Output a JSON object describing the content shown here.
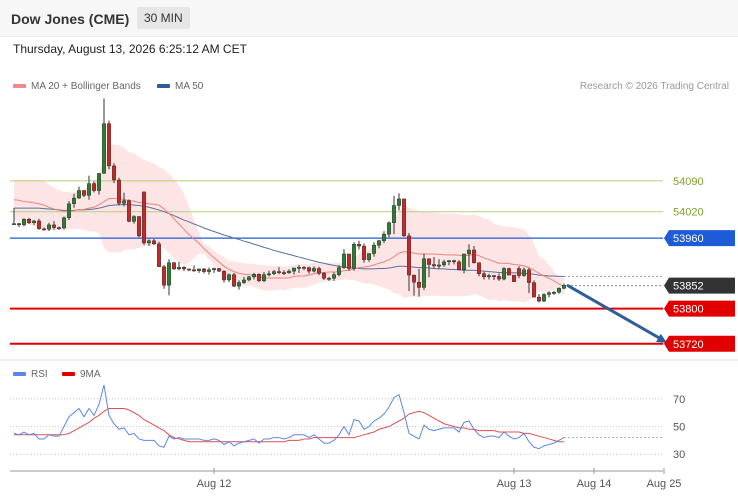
{
  "header": {
    "title": "Dow Jones (CME)",
    "timeframe": "30 MIN"
  },
  "datetime": "Thursday, August 13, 2026 6:25:12 AM CET",
  "legend": {
    "ma20_label": "MA 20 + Bollinger Bands",
    "ma50_label": "MA 50",
    "credit": "Research © 2026 Trading Central"
  },
  "rsi_legend": {
    "rsi_label": "RSI",
    "ma9_label": "9MA"
  },
  "colors": {
    "bull": "#2e7d32",
    "bear": "#c62828",
    "band": "#fde0e0",
    "ma20": "#f08080",
    "ma50": "#5a6f9e",
    "blue_level": "#1e5bd6",
    "red_level": "#e00000",
    "arrow": "#2f5d9c",
    "rsi": "#5b87e8",
    "rsi_ma": "#e05050"
  },
  "chart_data": {
    "type": "candlestick",
    "y_range": [
      53690,
      54310
    ],
    "levels": [
      {
        "value": 54090,
        "label": "54090",
        "style": "resistance-thin"
      },
      {
        "value": 54020,
        "label": "54020",
        "style": "resistance-thin"
      },
      {
        "value": 53960,
        "label": "53960",
        "style": "blue"
      },
      {
        "value": 53852,
        "label": "53852",
        "style": "current"
      },
      {
        "value": 53800,
        "label": "53800",
        "style": "red"
      },
      {
        "value": 53720,
        "label": "53720",
        "style": "red"
      }
    ],
    "x_labels": [
      {
        "label": "Aug 12",
        "index": 40
      },
      {
        "label": "Aug 13",
        "index": 100
      },
      {
        "label": "Aug 14",
        "index": 116
      },
      {
        "label": "Aug 25",
        "index": 130
      }
    ],
    "bars_count": 111,
    "candles": [
      [
        53992,
        53993,
        53993,
        54028
      ],
      [
        53993,
        53990,
        53985,
        53995
      ],
      [
        53990,
        54003,
        53987,
        54005
      ],
      [
        54003,
        53995,
        53992,
        54006
      ],
      [
        53995,
        53999,
        53990,
        54001
      ],
      [
        53999,
        53981,
        53979,
        54004
      ],
      [
        53981,
        53980,
        53978,
        53984
      ],
      [
        53980,
        53990,
        53976,
        53995
      ],
      [
        53990,
        53984,
        53979,
        53999
      ],
      [
        53984,
        53983,
        53979,
        53986
      ],
      [
        53983,
        54006,
        53980,
        54009
      ],
      [
        54006,
        54038,
        54001,
        54044
      ],
      [
        54038,
        54051,
        54029,
        54061
      ],
      [
        54051,
        54068,
        54049,
        54077
      ],
      [
        54068,
        54057,
        54053,
        54069
      ],
      [
        54057,
        54084,
        54047,
        54102
      ],
      [
        54084,
        54068,
        54064,
        54089
      ],
      [
        54068,
        54107,
        54059,
        54107
      ],
      [
        54107,
        54220,
        54106,
        54277
      ],
      [
        54220,
        54124,
        54116,
        54227
      ],
      [
        54124,
        54092,
        54085,
        54130
      ],
      [
        54092,
        54039,
        54034,
        54097
      ],
      [
        54039,
        54045,
        54032,
        54063
      ],
      [
        54045,
        53998,
        53996,
        54048
      ],
      [
        53998,
        54009,
        53993,
        54012
      ],
      [
        54009,
        53965,
        53962,
        54010
      ],
      [
        54065,
        53949,
        53944,
        53984
      ],
      [
        53949,
        53954,
        53942,
        53957
      ],
      [
        53954,
        53947,
        53944,
        53958
      ],
      [
        53947,
        53895,
        53895,
        53952
      ],
      [
        53895,
        53853,
        53845,
        53899
      ],
      [
        53853,
        53904,
        53830,
        53912
      ],
      [
        53904,
        53890,
        53888,
        53906
      ],
      [
        53890,
        53894,
        53887,
        53906
      ],
      [
        53894,
        53890,
        53885,
        53896
      ],
      [
        53890,
        53888,
        53885,
        53890
      ],
      [
        53888,
        53886,
        53884,
        53898
      ],
      [
        53886,
        53890,
        53881,
        53891
      ],
      [
        53890,
        53884,
        53880,
        53892
      ],
      [
        53884,
        53888,
        53877,
        53893
      ],
      [
        53888,
        53891,
        53881,
        53893
      ],
      [
        53891,
        53885,
        53883,
        53892
      ],
      [
        53885,
        53865,
        53859,
        53887
      ],
      [
        53865,
        53877,
        53860,
        53880
      ],
      [
        53877,
        53851,
        53849,
        53881
      ],
      [
        53851,
        53859,
        53843,
        53864
      ],
      [
        53859,
        53865,
        53856,
        53872
      ],
      [
        53865,
        53872,
        53862,
        53874
      ],
      [
        53872,
        53878,
        53866,
        53881
      ],
      [
        53878,
        53863,
        53860,
        53880
      ],
      [
        53863,
        53877,
        53860,
        53883
      ],
      [
        53877,
        53879,
        53873,
        53886
      ],
      [
        53879,
        53884,
        53876,
        53888
      ],
      [
        53884,
        53882,
        53878,
        53894
      ],
      [
        53882,
        53881,
        53876,
        53887
      ],
      [
        53881,
        53885,
        53879,
        53889
      ],
      [
        53885,
        53892,
        53877,
        53893
      ],
      [
        53892,
        53894,
        53881,
        53899
      ],
      [
        53894,
        53893,
        53887,
        53896
      ],
      [
        53893,
        53885,
        53879,
        53895
      ],
      [
        53885,
        53891,
        53882,
        53896
      ],
      [
        53891,
        53880,
        53876,
        53895
      ],
      [
        53880,
        53869,
        53865,
        53883
      ],
      [
        53869,
        53869,
        53863,
        53872
      ],
      [
        53869,
        53877,
        53863,
        53882
      ],
      [
        53877,
        53893,
        53873,
        53898
      ],
      [
        53893,
        53924,
        53890,
        53935
      ],
      [
        53924,
        53891,
        53886,
        53924
      ],
      [
        53891,
        53946,
        53886,
        53951
      ],
      [
        53946,
        53942,
        53934,
        53954
      ],
      [
        53942,
        53911,
        53904,
        53948
      ],
      [
        53911,
        53925,
        53906,
        53926
      ],
      [
        53925,
        53944,
        53918,
        53951
      ],
      [
        53944,
        53954,
        53937,
        53956
      ],
      [
        53954,
        53969,
        53949,
        53976
      ],
      [
        53969,
        53995,
        53962,
        53998
      ],
      [
        53995,
        54034,
        53969,
        54056
      ],
      [
        54034,
        54049,
        54023,
        54062
      ],
      [
        54049,
        53965,
        53963,
        54049
      ],
      [
        53965,
        53876,
        53840,
        53972
      ],
      [
        53876,
        53860,
        53829,
        53877
      ],
      [
        53860,
        53848,
        53827,
        53890
      ],
      [
        53848,
        53913,
        53842,
        53925
      ],
      [
        53913,
        53900,
        53871,
        53914
      ],
      [
        53900,
        53897,
        53892,
        53917
      ],
      [
        53897,
        53899,
        53891,
        53912
      ],
      [
        53899,
        53906,
        53895,
        53911
      ],
      [
        53906,
        53909,
        53898,
        53910
      ],
      [
        53909,
        53906,
        53900,
        53911
      ],
      [
        53906,
        53888,
        53887,
        53910
      ],
      [
        53888,
        53924,
        53880,
        53924
      ],
      [
        53924,
        53933,
        53894,
        53946
      ],
      [
        53933,
        53904,
        53902,
        53942
      ],
      [
        53904,
        53879,
        53873,
        53905
      ],
      [
        53879,
        53872,
        53866,
        53884
      ],
      [
        53872,
        53875,
        53866,
        53879
      ],
      [
        53875,
        53873,
        53865,
        53876
      ],
      [
        53873,
        53867,
        53863,
        53880
      ],
      [
        53867,
        53891,
        53864,
        53894
      ],
      [
        53891,
        53876,
        53876,
        53893
      ],
      [
        53876,
        53861,
        53862,
        53876
      ],
      [
        53891,
        53875,
        53869,
        53896
      ],
      [
        53875,
        53888,
        53872,
        53893
      ],
      [
        53888,
        53859,
        53835,
        53892
      ],
      [
        53859,
        53826,
        53827,
        53864
      ],
      [
        53826,
        53817,
        53814,
        53833
      ],
      [
        53817,
        53832,
        53815,
        53835
      ],
      [
        53832,
        53836,
        53825,
        53839
      ],
      [
        53836,
        53837,
        53831,
        53840
      ],
      [
        53837,
        53846,
        53834,
        53848
      ],
      [
        53846,
        53853,
        53844,
        53857
      ]
    ],
    "ma20": [
      54047,
      54046,
      54043,
      54042,
      54040,
      54038,
      54035,
      54030,
      54026,
      54023,
      54021,
      54022,
      54022,
      54025,
      54025,
      54028,
      54030,
      54036,
      54043,
      54050,
      54050,
      54049,
      54048,
      54045,
      54044,
      54041,
      54040,
      54038,
      54037,
      54035,
      54026,
      54016,
      54004,
      53992,
      53980,
      53968,
      53958,
      53948,
      53936,
      53926,
      53915,
      53906,
      53896,
      53889,
      53884,
      53880,
      53878,
      53877,
      53875,
      53872,
      53870,
      53869,
      53869,
      53870,
      53869,
      53870,
      53873,
      53874,
      53874,
      53876,
      53879,
      53881,
      53882,
      53883,
      53883,
      53884,
      53886,
      53887,
      53890,
      53893,
      53894,
      53896,
      53899,
      53903,
      53906,
      53911,
      53918,
      53926,
      53929,
      53928,
      53926,
      53924,
      53924,
      53924,
      53924,
      53923,
      53922,
      53922,
      53922,
      53921,
      53920,
      53921,
      53923,
      53920,
      53915,
      53911,
      53907,
      53903,
      53903,
      53902,
      53900,
      53899,
      53897,
      53893,
      53887,
      53880,
      53874,
      53869,
      53863,
      53856,
      53850
    ],
    "upper_band": [
      54093,
      54093,
      54093,
      54093,
      54093,
      54093,
      54089,
      54081,
      54075,
      54068,
      54065,
      54064,
      54063,
      54070,
      54071,
      54080,
      54085,
      54101,
      54148,
      54172,
      54172,
      54171,
      54165,
      54155,
      54153,
      54144,
      54138,
      54134,
      54129,
      54121,
      54116,
      54106,
      54094,
      54080,
      54061,
      54033,
      54002,
      53971,
      53948,
      53941,
      53932,
      53923,
      53917,
      53909,
      53907,
      53905,
      53903,
      53902,
      53901,
      53899,
      53899,
      53897,
      53897,
      53897,
      53896,
      53896,
      53899,
      53901,
      53901,
      53902,
      53904,
      53903,
      53903,
      53904,
      53904,
      53904,
      53906,
      53909,
      53915,
      53925,
      53932,
      53935,
      53943,
      53955,
      53966,
      53979,
      54001,
      54019,
      54034,
      54029,
      54025,
      54022,
      54019,
      54019,
      54019,
      54017,
      54016,
      54016,
      54016,
      54014,
      54012,
      54012,
      54013,
      54010,
      54005,
      54003,
      53993,
      53989,
      53987,
      53986,
      53984,
      53982,
      53980,
      53967,
      53949,
      53919,
      53913,
      53899,
      53884,
      53872,
      53870
    ],
    "lower_band": [
      54001,
      53999,
      53993,
      53991,
      53987,
      53983,
      53981,
      53979,
      53977,
      53978,
      53977,
      53980,
      53981,
      53980,
      53979,
      53976,
      53975,
      53971,
      53938,
      53928,
      53928,
      53927,
      53931,
      53935,
      53935,
      53938,
      53942,
      53942,
      53945,
      53949,
      53936,
      53926,
      53914,
      53904,
      53899,
      53903,
      53914,
      53925,
      53924,
      53911,
      53898,
      53889,
      53875,
      53869,
      53861,
      53855,
      53853,
      53852,
      53849,
      53845,
      53841,
      53841,
      53841,
      53843,
      53842,
      53844,
      53847,
      53847,
      53847,
      53850,
      53854,
      53859,
      53861,
      53862,
      53862,
      53864,
      53866,
      53865,
      53865,
      53861,
      53856,
      53857,
      53855,
      53851,
      53846,
      53843,
      53835,
      53833,
      53824,
      53827,
      53827,
      53826,
      53829,
      53829,
      53829,
      53829,
      53828,
      53828,
      53828,
      53828,
      53828,
      53830,
      53833,
      53830,
      53825,
      53819,
      53821,
      53817,
      53819,
      53818,
      53816,
      53816,
      53814,
      53819,
      53825,
      53841,
      53835,
      53839,
      53842,
      53840,
      53830
    ],
    "ma50": [
      54028,
      54028,
      54028,
      54028,
      54028,
      54028,
      54027,
      54026,
      54025,
      54024,
      54023,
      54023,
      54023,
      54024,
      54024,
      54025,
      54026,
      54028,
      54031,
      54034,
      54035,
      54036,
      54036,
      54036,
      54035,
      54034,
      54032,
      54030,
      54027,
      54024,
      54020,
      54016,
      54011,
      54006,
      54001,
      53997,
      53992,
      53988,
      53983,
      53979,
      53975,
      53971,
      53967,
      53964,
      53960,
      53957,
      53953,
      53950,
      53946,
      53943,
      53939,
      53936,
      53932,
      53929,
      53926,
      53923,
      53920,
      53917,
      53914,
      53911,
      53908,
      53905,
      53903,
      53900,
      53898,
      53896,
      53894,
      53893,
      53892,
      53891,
      53890,
      53890,
      53890,
      53891,
      53891,
      53892,
      53894,
      53896,
      53896,
      53895,
      53894,
      53893,
      53893,
      53892,
      53891,
      53890,
      53890,
      53889,
      53889,
      53888,
      53887,
      53887,
      53887,
      53886,
      53885,
      53884,
      53883,
      53882,
      53882,
      53881,
      53881,
      53881,
      53880,
      53879,
      53878,
      53876,
      53875,
      53874,
      53874,
      53873,
      53873
    ],
    "projection": {
      "from": [
        110,
        53852
      ],
      "to": [
        130,
        53720
      ]
    },
    "rsi": {
      "y_range": [
        20,
        80
      ],
      "levels": [
        70,
        50,
        30
      ],
      "values": [
        45,
        44,
        46,
        44,
        45,
        41,
        41,
        44,
        43,
        43,
        50,
        57,
        60,
        63,
        57,
        63,
        58,
        66,
        80,
        58,
        52,
        48,
        49,
        44,
        45,
        41,
        40,
        40,
        40,
        36,
        35,
        43,
        41,
        42,
        41,
        41,
        41,
        41,
        40,
        40,
        41,
        40,
        37,
        39,
        36,
        38,
        39,
        40,
        41,
        38,
        41,
        41,
        42,
        42,
        41,
        42,
        44,
        44,
        44,
        42,
        44,
        41,
        38,
        38,
        40,
        44,
        50,
        44,
        55,
        54,
        48,
        50,
        54,
        56,
        59,
        64,
        71,
        73,
        60,
        45,
        43,
        41,
        51,
        48,
        47,
        48,
        49,
        49,
        49,
        46,
        53,
        54,
        48,
        44,
        42,
        43,
        43,
        42,
        46,
        43,
        41,
        42,
        45,
        39,
        35,
        34,
        36,
        37,
        38,
        40,
        42
      ],
      "ma9": [
        44,
        44,
        44,
        44,
        44,
        44,
        44,
        44,
        44,
        44,
        44,
        45,
        47,
        49,
        51,
        53,
        56,
        58,
        61,
        63,
        63,
        63,
        63,
        62,
        60,
        58,
        55,
        53,
        51,
        49,
        47,
        44,
        42,
        41,
        40,
        39,
        39,
        39,
        39,
        39,
        39,
        39,
        39,
        39,
        39,
        39,
        39,
        39,
        39,
        39,
        39,
        39,
        39,
        39,
        39,
        40,
        40,
        40,
        41,
        41,
        42,
        42,
        42,
        42,
        42,
        42,
        42,
        42,
        42,
        43,
        44,
        45,
        46,
        48,
        49,
        50,
        52,
        54,
        56,
        59,
        60,
        61,
        60,
        58,
        56,
        54,
        52,
        51,
        50,
        49,
        49,
        48,
        48,
        47,
        47,
        47,
        47,
        46,
        46,
        46,
        46,
        46,
        45,
        45,
        44,
        43,
        42,
        41,
        40,
        39,
        39
      ]
    }
  }
}
